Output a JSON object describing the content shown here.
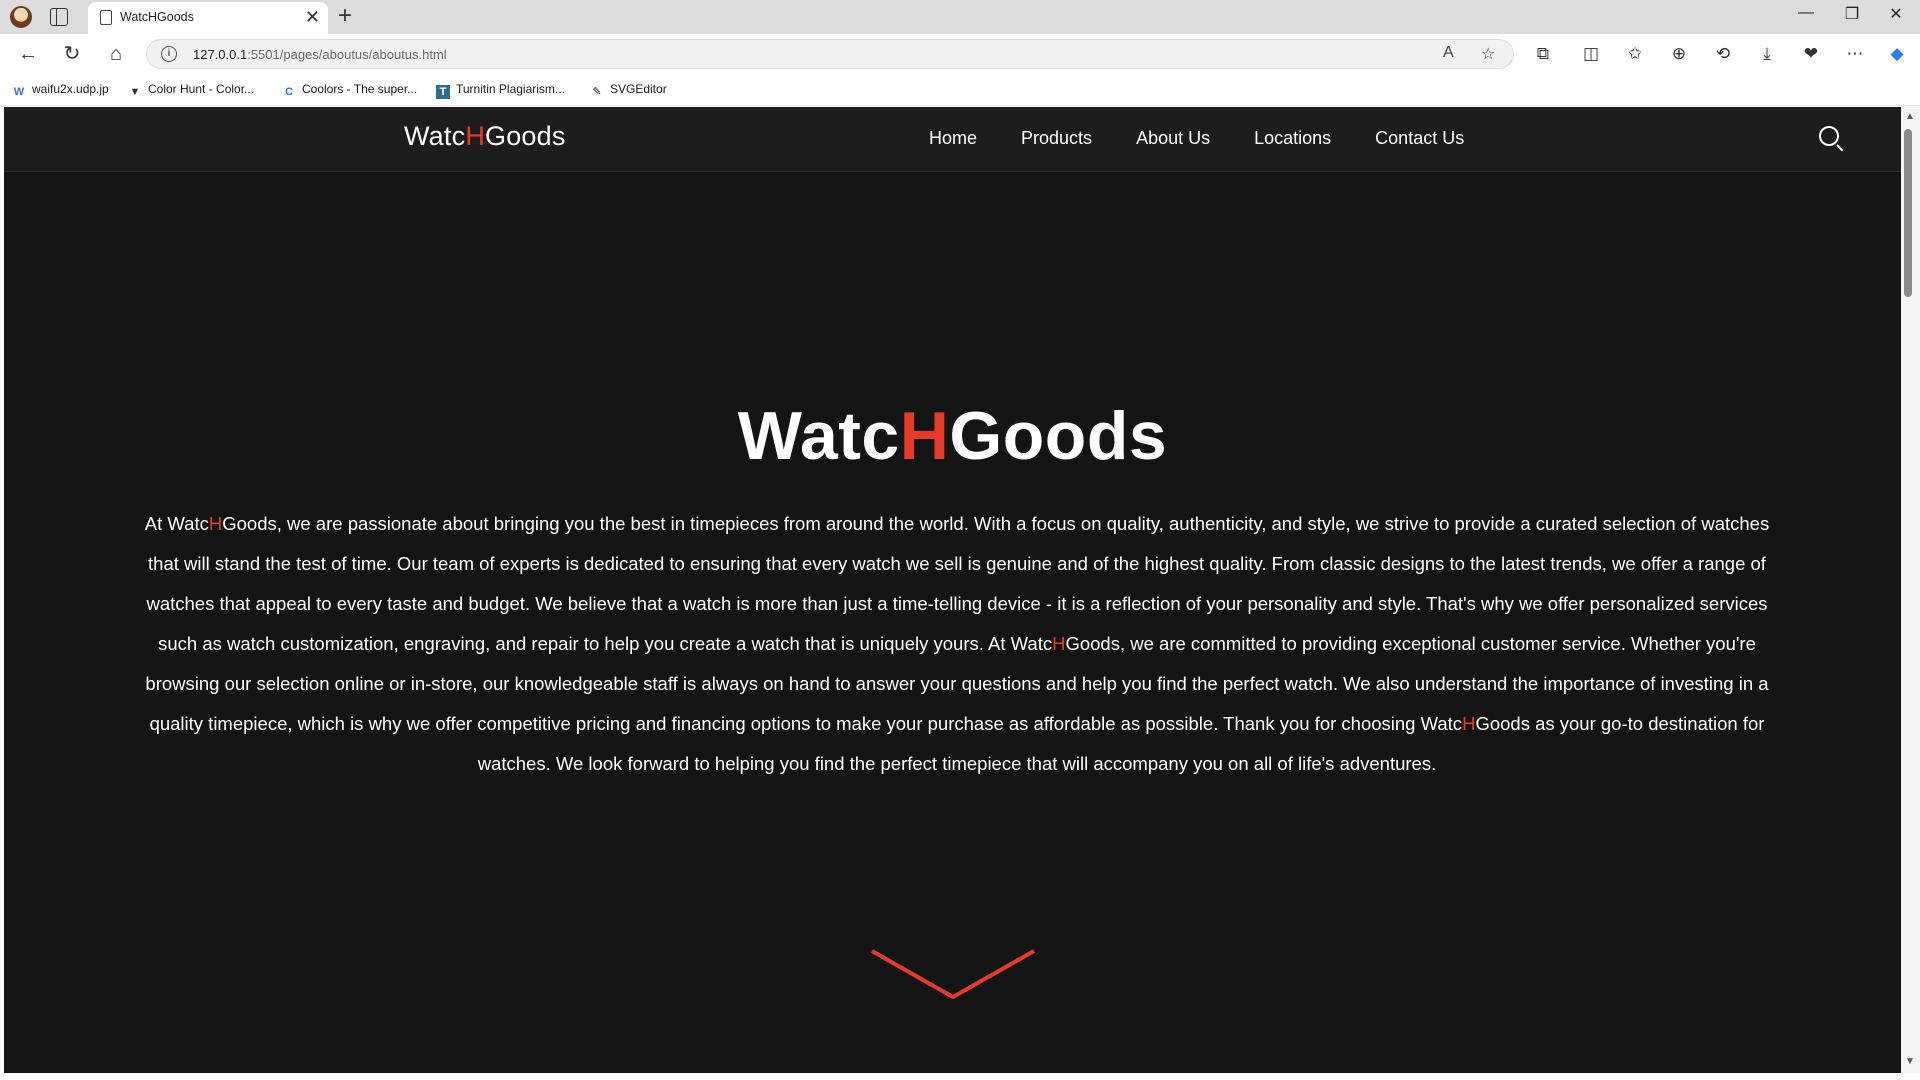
{
  "browser": {
    "tab_title": "WatcHGoods",
    "tab_close": "✕",
    "new_tab": "+",
    "url_host": "127.0.0.1",
    "url_rest": ":5501/pages/aboutus/aboutus.html",
    "window_controls": [
      "—",
      "❐",
      "✕"
    ],
    "bookmarks": [
      {
        "label": "waifu2x.udp.jp",
        "icon": "W"
      },
      {
        "label": "Color Hunt - Color...",
        "icon": "▼"
      },
      {
        "label": "Coolors - The super...",
        "icon": "C"
      },
      {
        "label": "Turnitin Plagiarism...",
        "icon": "T"
      },
      {
        "label": "SVGEditor",
        "icon": "✎"
      }
    ]
  },
  "site": {
    "logo_pre": "Watc",
    "logo_mid": "H",
    "logo_post": "Goods",
    "menu": [
      "Home",
      "Products",
      "About Us",
      "Locations",
      "Contact Us"
    ],
    "accent_color": "#e63a2a"
  },
  "hero": {
    "title_pre": "Watc",
    "title_mid": "H",
    "title_post": "Goods"
  },
  "about": {
    "p1": "At Watc",
    "h1": "H",
    "p2": "Goods, we are passionate about bringing you the best in timepieces from around the world. With a focus on quality, authenticity, and style, we strive to provide a curated selection of watches that will stand the test of time. Our team of experts is dedicated to ensuring that every watch we sell is genuine and of the highest quality. From classic designs to the latest trends, we offer a range of watches that appeal to every taste and budget. We believe that a watch is more than just a time-telling device - it is a reflection of your personality and style. That's why we offer personalized services such as watch customization, engraving, and repair to help you create a watch that is uniquely yours. At Watc",
    "h2": "H",
    "p3": "Goods, we are committed to providing exceptional customer service. Whether you're browsing our selection online or in-store, our knowledgeable staff is always on hand to answer your questions and help you find the perfect watch. We also understand the importance of investing in a quality timepiece, which is why we offer competitive pricing and financing options to make your purchase as affordable as possible. Thank you for choosing Watc",
    "h3": "H",
    "p4": "Goods as your go-to destination for watches. We look forward to helping you find the perfect timepiece that will accompany you on all of life's adventures."
  }
}
